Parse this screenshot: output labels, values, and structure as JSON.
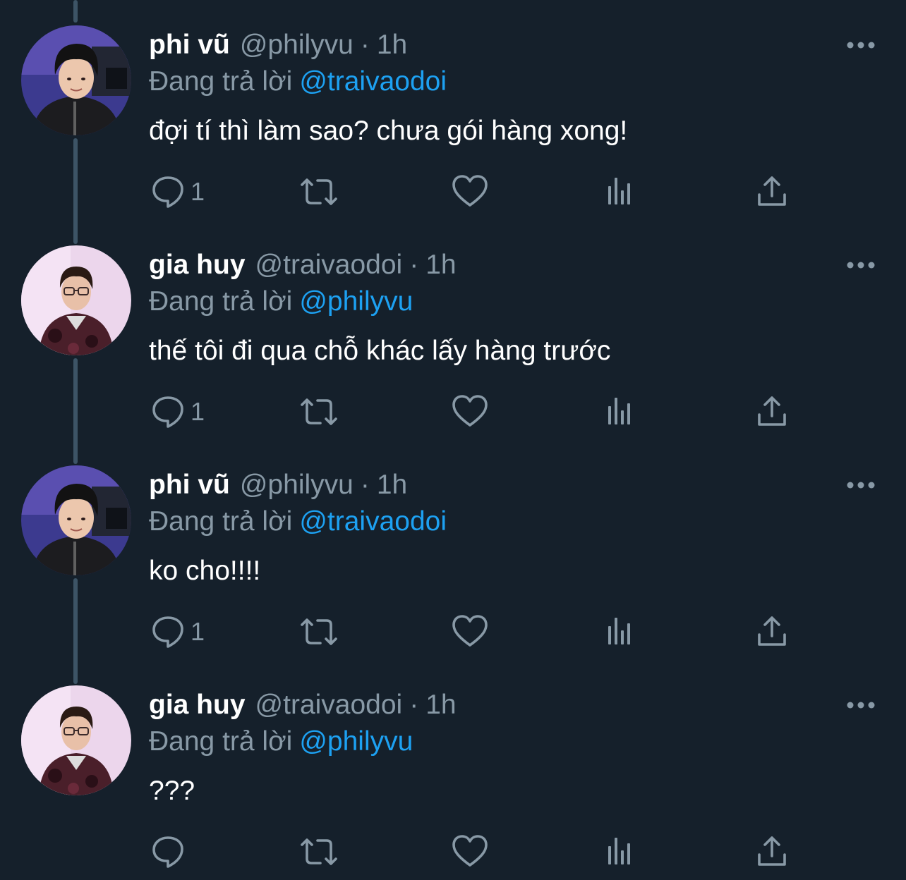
{
  "colors": {
    "background": "#15202b",
    "primary_text": "#ffffff",
    "secondary_text": "#8899a6",
    "accent": "#1da1f2",
    "thread_line": "#3d5466"
  },
  "icons": {
    "reply": "reply-icon",
    "retweet": "retweet-icon",
    "like": "like-icon",
    "stats": "stats-icon",
    "share": "share-icon",
    "more": "more-icon"
  },
  "tweets": [
    {
      "display_name": "phi vũ",
      "handle": "@philyvu",
      "separator": "·",
      "time": "1h",
      "replying_label": "Đang trả lời",
      "replying_to": "@traivaodoi",
      "text": "đợi tí thì làm sao? chưa gói hàng xong!",
      "reply_count": "1"
    },
    {
      "display_name": "gia huy",
      "handle": "@traivaodoi",
      "separator": "·",
      "time": "1h",
      "replying_label": "Đang trả lời",
      "replying_to": "@philyvu",
      "text": "thế tôi đi qua chỗ khác lấy hàng trước",
      "reply_count": "1"
    },
    {
      "display_name": "phi vũ",
      "handle": "@philyvu",
      "separator": "·",
      "time": "1h",
      "replying_label": "Đang trả lời",
      "replying_to": "@traivaodoi",
      "text": "ko cho!!!!",
      "reply_count": "1"
    },
    {
      "display_name": "gia huy",
      "handle": "@traivaodoi",
      "separator": "·",
      "time": "1h",
      "replying_label": "Đang trả lời",
      "replying_to": "@philyvu",
      "text": "???",
      "reply_count": ""
    }
  ]
}
